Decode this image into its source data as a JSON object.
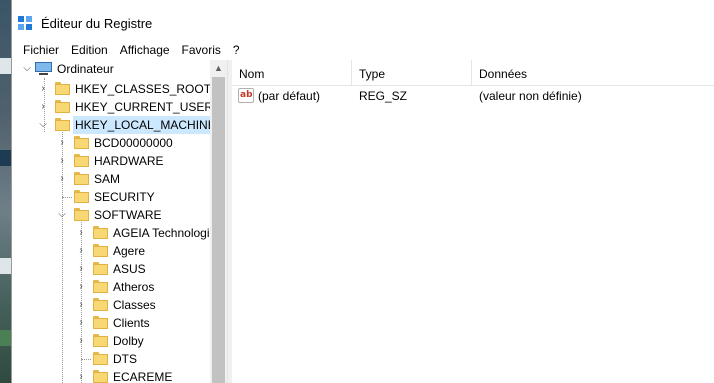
{
  "window": {
    "title": "Éditeur du Registre"
  },
  "menu": [
    "Fichier",
    "Edition",
    "Affichage",
    "Favoris",
    "?"
  ],
  "tree": {
    "root": "Ordinateur",
    "hives": [
      "HKEY_CLASSES_ROOT",
      "HKEY_CURRENT_USER",
      "HKEY_LOCAL_MACHINE"
    ],
    "hklm_children": [
      "BCD00000000",
      "HARDWARE",
      "SAM",
      "SECURITY",
      "SOFTWARE"
    ],
    "software_children": [
      "AGEIA Technologi",
      "Agere",
      "ASUS",
      "Atheros",
      "Classes",
      "Clients",
      "Dolby",
      "DTS",
      "ECAREME"
    ],
    "selected": "HKEY_LOCAL_MACHINE"
  },
  "list": {
    "columns": [
      "Nom",
      "Type",
      "Données"
    ],
    "rows": [
      {
        "name": "(par défaut)",
        "type": "REG_SZ",
        "data": "(valeur non définie)",
        "icon": "string-value-icon"
      }
    ]
  },
  "icons": {
    "app": "registry-editor-icon",
    "computer": "computer-icon",
    "folder": "folder-icon",
    "expand": "chevron-right-icon",
    "collapse": "chevron-down-icon"
  },
  "colors": {
    "selection": "#cce8ff",
    "folder": "#f8d775",
    "app_icon": "#1e7ad6"
  }
}
